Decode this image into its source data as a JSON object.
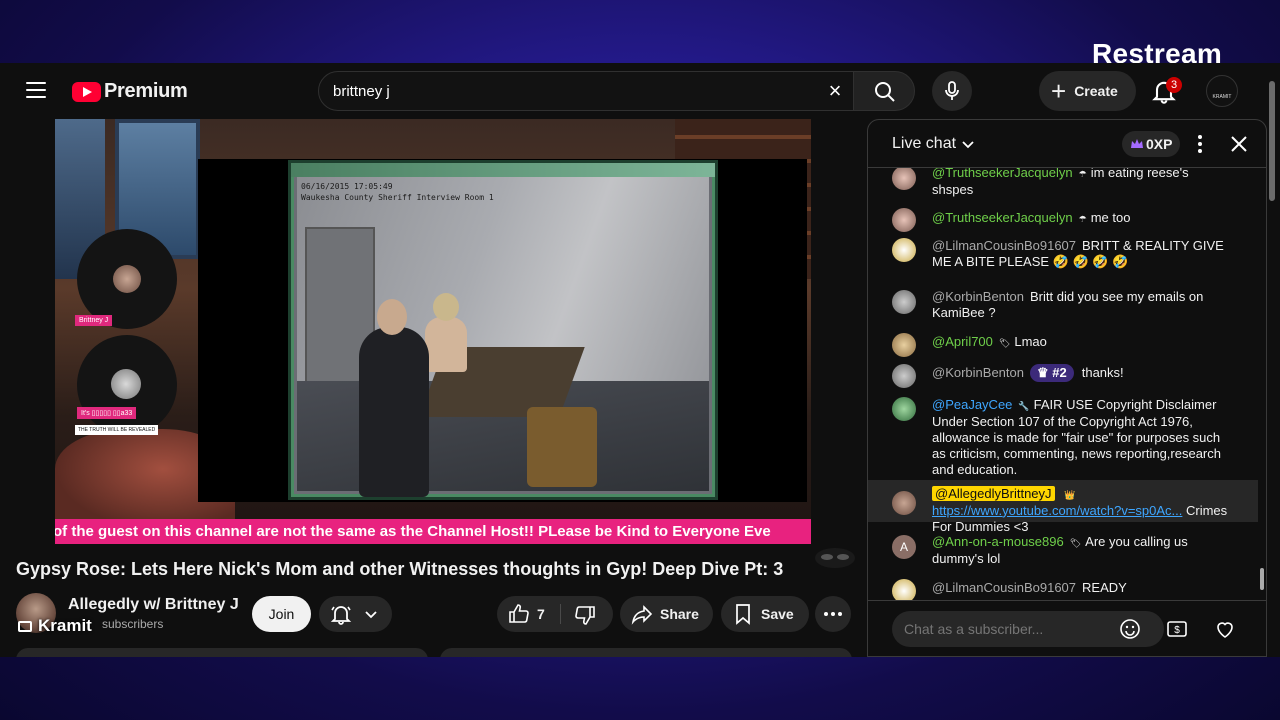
{
  "overlay": {
    "brand": "Restream",
    "streamer": "Kramit"
  },
  "topbar": {
    "logo_text": "Premium",
    "search_value": "brittney j",
    "create_label": "Create",
    "notification_count": "3"
  },
  "video": {
    "title": "Gypsy Rose: Lets Here Nick's Mom and other Witnesses thoughts in Gyp! Deep Dive Pt: 3",
    "ticker": "of the guest on this channel are not the same as the Channel Host!! PLease be Kind to Everyone Eve",
    "host_tag": "Brittney J",
    "guest_tag": "It's ▯▯▯▯▯ ▯▯a33",
    "guest_subtag": "THE TRUTH WILL BE REVEALED",
    "cctv_timestamp": "06/16/2015 17:05:49",
    "cctv_location": "Waukesha County Sheriff Interview Room 1"
  },
  "channel": {
    "name": "Allegedly w/ Brittney J",
    "subscribers": "subscribers",
    "join_label": "Join",
    "like_count": "7",
    "share_label": "Share",
    "save_label": "Save"
  },
  "chat": {
    "title": "Live chat",
    "xp": "0XP",
    "input_placeholder": "Chat as a subscriber...",
    "messages": [
      {
        "author": "@TruthseekerJacquelyn",
        "text": "im eating reese's shspes"
      },
      {
        "author": "@TruthseekerJacquelyn",
        "text": "me too"
      },
      {
        "author": "@LilmanCousinBo91607",
        "text": "BRITT & REALITY GIVE ME A BITE PLEASE 🤣 🤣 🤣 🤣"
      },
      {
        "author": "@KorbinBenton",
        "text": "Britt did you see my emails on KamiBee ?"
      },
      {
        "author": "@April700",
        "text": "Lmao"
      },
      {
        "author": "@KorbinBenton",
        "rank": "#2",
        "text": "thanks!"
      },
      {
        "author": "@PeaJayCee",
        "text": "FAIR USE Copyright Disclaimer Under Section 107 of the Copyright Act 1976, allowance is made for \"fair use\" for purposes such as criticism, commenting, news reporting,research and education."
      },
      {
        "author": "@AllegedlyBrittneyJ",
        "link": "https://www.youtube.com/watch?v=sp0Ac...",
        "text": "Crimes For Dummies <3"
      },
      {
        "author": "@Ann-on-a-mouse896",
        "text": "Are you calling us dummy's lol"
      },
      {
        "author": "@LilmanCousinBo91607",
        "text": "READY"
      }
    ]
  },
  "colors": {
    "accent_red": "#ff0033",
    "ticker_pink": "#e8227f",
    "member_green": "#6fcf4a",
    "owner_yellow": "#ffd600",
    "link_blue": "#3ea6ff"
  }
}
